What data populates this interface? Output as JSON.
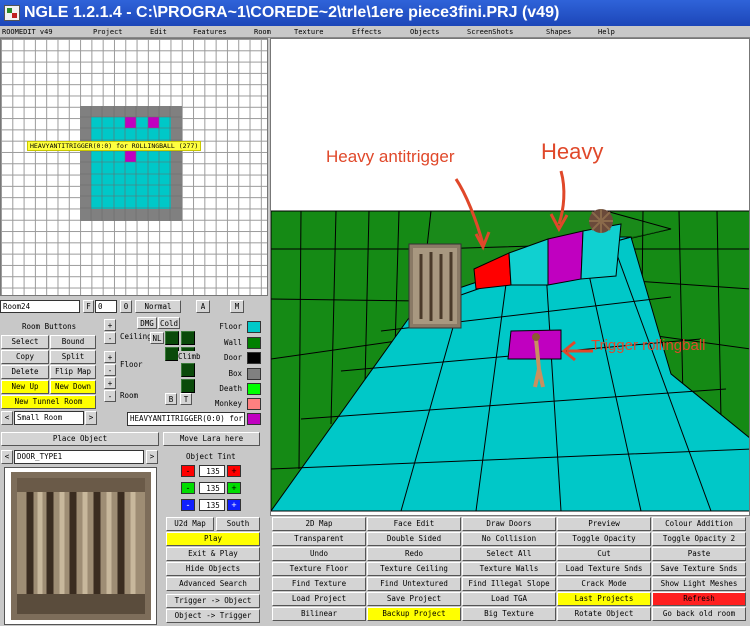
{
  "window": {
    "title": "NGLE 1.2.1.4 - C:\\PROGRA~1\\COREDE~2\\trle\\1ere piece3fini.PRJ  (v49)"
  },
  "menu": [
    "ROOMEDIT v49",
    "Project",
    "Edit",
    "Features",
    "Room",
    "Texture",
    "Effects",
    "Objects",
    "ScreenShots",
    "Shapes",
    "Help"
  ],
  "map": {
    "trigger_label": "HEAVYANTITRIGGER(0:0)  for  ROLLINGBALL  (277)"
  },
  "room": {
    "name": "Room24",
    "f_label": "F",
    "f_value": "0",
    "o_value": "0",
    "normal_label": "Normal",
    "a_label": "A",
    "m_label": "M",
    "buttons_title": "Room Buttons",
    "select": "Select",
    "bound": "Bound",
    "copy": "Copy",
    "split": "Split",
    "delete": "Delete",
    "flip_map": "Flip Map",
    "new_up": "New Up",
    "new_down": "New Down",
    "new_tunnel_room": "New Tunnel Room",
    "size_value": "Small Room",
    "dmg": "DMG",
    "cold": "Cold",
    "ceiling": "Ceiling",
    "nl": "NL",
    "floor": "Floor",
    "climb": "Climb",
    "room_lbl": "Room",
    "b": "B",
    "t": "T",
    "trigger_field": "HEAVYANTITRIGGER(0:0)  for ROLLINGBALL"
  },
  "legend": [
    {
      "label": "Floor",
      "color": "#00c8c8"
    },
    {
      "label": "Wall",
      "color": "#008000"
    },
    {
      "label": "Door",
      "color": "#000000"
    },
    {
      "label": "Box",
      "color": "#808080"
    },
    {
      "label": "Death",
      "color": "#00ff00"
    },
    {
      "label": "Monkey",
      "color": "#ff8080"
    },
    {
      "label": "",
      "color": "#c000c0"
    }
  ],
  "object": {
    "place_object": "Place Object",
    "move_lara": "Move Lara here",
    "type": "DOOR_TYPE1",
    "tint_title": "Object Tint",
    "tint_r": "135",
    "tint_g": "135",
    "tint_b": "135",
    "u2d_map": "U2d Map",
    "south": "South",
    "play": "Play",
    "exit_play": "Exit & Play",
    "hide_objects": "Hide Objects",
    "advanced_search": "Advanced Search",
    "trigger_object": "Trigger -> Object",
    "object_trigger": "Object -> Trigger"
  },
  "annotations": {
    "heavy_antitrigger": "Heavy antitrigger",
    "heavy": "Heavy",
    "trigger_rollingball": "Trigger rollingball"
  },
  "toolbar": [
    [
      "2D Map",
      "Face Edit",
      "Draw Doors",
      "Preview",
      "Colour Addition"
    ],
    [
      "Transparent",
      "Double Sided",
      "No Collision",
      "Toggle Opacity",
      "Toggle Opacity 2"
    ],
    [
      "Undo",
      "Redo",
      "Select All",
      "Cut",
      "Paste"
    ],
    [
      "Texture Floor",
      "Texture Ceiling",
      "Texture Walls",
      "Load Texture Snds",
      "Save Texture Snds"
    ],
    [
      "Find Texture",
      "Find Untextured",
      "Find Illegal Slope",
      "Crack Mode",
      "Show Light Meshes"
    ],
    [
      "Load Project",
      "Save Project",
      "Load TGA",
      "Last Projects",
      "Refresh"
    ],
    [
      "Bilinear",
      "Backup Project",
      "Big Texture",
      "Rotate Object",
      "Go back old room"
    ]
  ],
  "colors": {
    "yellow": "#ffff00",
    "red": "#ff2020",
    "magenta": "#c000c0",
    "floor": "#00c8c8",
    "wall": "#008000"
  }
}
